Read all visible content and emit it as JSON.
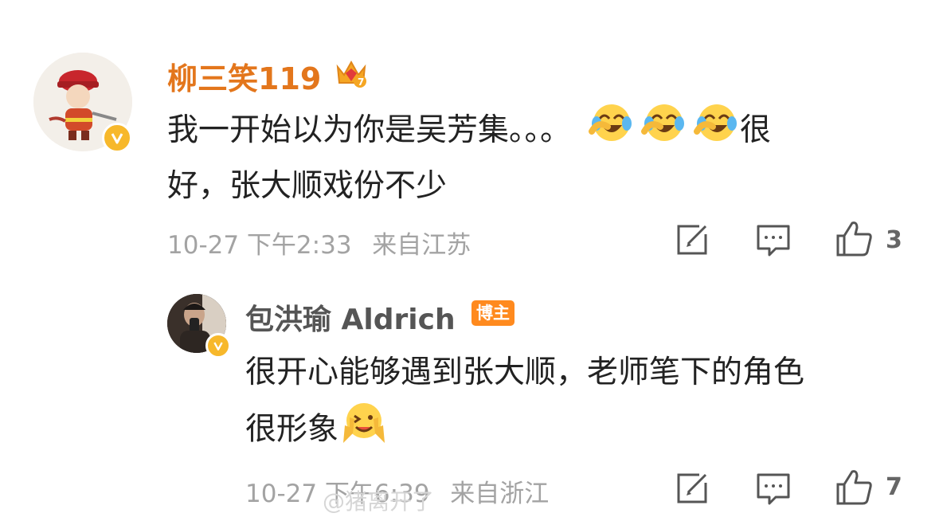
{
  "comment": {
    "author": "柳三笑119",
    "text_line1_a": "我一开始以为你是吴芳集。。。",
    "text_line1_b": "很",
    "text_line2": "好，张大顺戏份不少",
    "date": "10-27 下午2:33",
    "location": "来自江苏",
    "like_count": "3",
    "emoji_count": 3,
    "emoji_name": "laugh-cry-emoji"
  },
  "reply": {
    "author": "包洪瑜 Aldrich",
    "badge": "博主",
    "text_line1": "很开心能够遇到张大顺，老师笔下的角色",
    "text_line2": "很形象",
    "date": "10-27 下午6:39",
    "location": "来自浙江",
    "like_count": "7",
    "emoji_name": "yeah-emoji"
  },
  "watermark": "@猪离开了",
  "colors": {
    "author_orange": "#e3761c",
    "badge_orange": "#ff8a1e",
    "verified_yellow": "#f7b82b",
    "meta_gray": "#a3a3a3"
  }
}
